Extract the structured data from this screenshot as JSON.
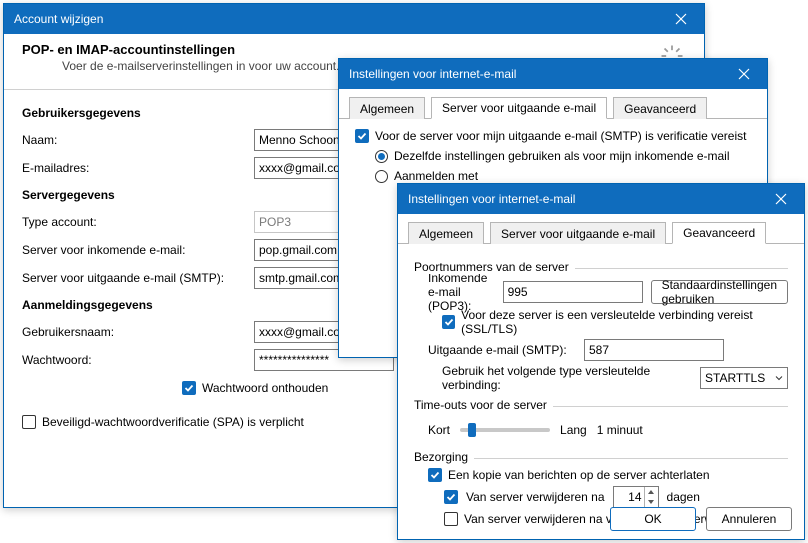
{
  "dlg1": {
    "title": "Account wijzigen",
    "heading": "POP- en IMAP-accountinstellingen",
    "sub": "Voer de e-mailserverinstellingen in voor uw account.",
    "sections": {
      "user": "Gebruikersgegevens",
      "server": "Servergegevens",
      "login": "Aanmeldingsgegevens"
    },
    "labels": {
      "name": "Naam:",
      "email": "E-mailadres:",
      "account_type": "Type account:",
      "incoming": "Server voor inkomende e-mail:",
      "outgoing": "Server voor uitgaande e-mail (SMTP):",
      "username": "Gebruikersnaam:",
      "password": "Wachtwoord:",
      "remember": "Wachtwoord onthouden",
      "spa": "Beveiligd-wachtwoordverificatie (SPA) is verplicht"
    },
    "values": {
      "name": "Menno Schoone",
      "email": "xxxx@gmail.com",
      "account_type": "POP3",
      "incoming": "pop.gmail.com",
      "outgoing": "smtp.gmail.com",
      "username": "xxxx@gmail.com",
      "password": "***************"
    }
  },
  "dlg2": {
    "title": "Instellingen voor internet-e-mail",
    "tabs": {
      "general": "Algemeen",
      "outgoing": "Server voor uitgaande e-mail",
      "advanced": "Geavanceerd"
    },
    "verify": "Voor de server voor mijn uitgaande e-mail (SMTP) is verificatie vereist",
    "same": "Dezelfde instellingen gebruiken als voor mijn inkomende e-mail",
    "login_with": "Aanmelden met"
  },
  "dlg3": {
    "title": "Instellingen voor internet-e-mail",
    "tabs": {
      "general": "Algemeen",
      "outgoing": "Server voor uitgaande e-mail",
      "advanced": "Geavanceerd"
    },
    "sections": {
      "ports": "Poortnummers van de server",
      "timeouts": "Time-outs voor de server",
      "delivery": "Bezorging"
    },
    "labels": {
      "incoming": "Inkomende e-mail (POP3):",
      "defaults_btn": "Standaardinstellingen gebruiken",
      "ssl": "Voor deze server is een versleutelde verbinding vereist (SSL/TLS)",
      "outgoing": "Uitgaande e-mail (SMTP):",
      "enc_type": "Gebruik het volgende type versleutelde verbinding:",
      "short": "Kort",
      "long": "Lang",
      "timeout_val": "1 minuut",
      "leave_copy": "Een kopie van berichten op de server achterlaten",
      "remove_after_pre": "Van server verwijderen na",
      "remove_after_post": "dagen",
      "remove_deleted": "Van server verwijderen na verwijderen uit Verwijderde items",
      "ok": "OK",
      "cancel": "Annuleren"
    },
    "values": {
      "pop_port": "995",
      "smtp_port": "587",
      "enc_type": "STARTTLS",
      "days": "14"
    }
  }
}
